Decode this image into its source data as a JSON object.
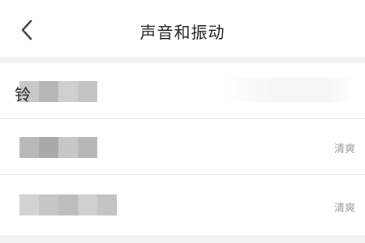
{
  "header": {
    "back_icon": "chevron-left-icon",
    "title": "声音和振动"
  },
  "settings": [
    {
      "label_visible_char": "铃",
      "value": ""
    },
    {
      "label_visible_char": "",
      "value": "清爽"
    },
    {
      "label_visible_char": "",
      "value": "清爽"
    }
  ]
}
